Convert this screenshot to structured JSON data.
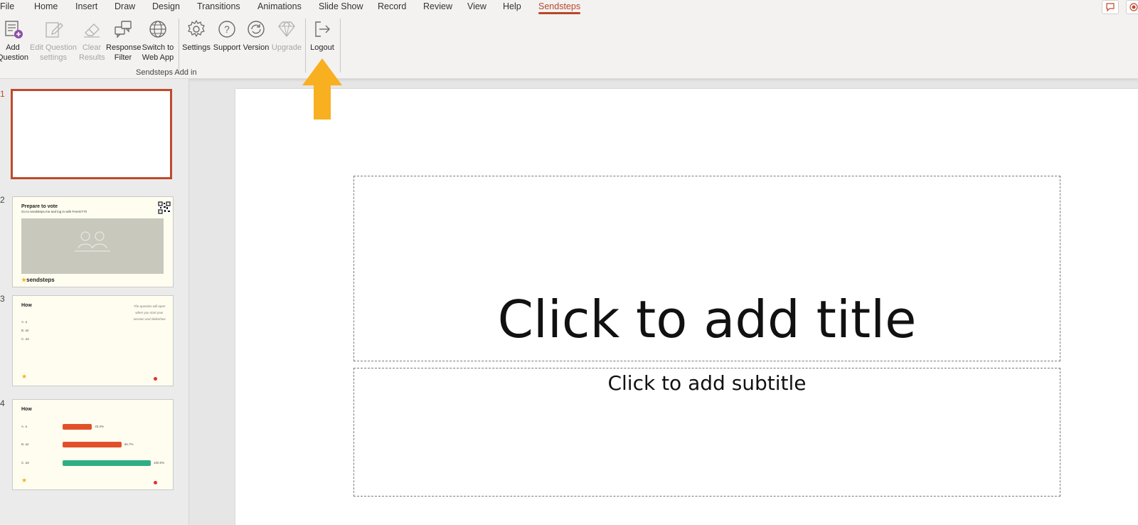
{
  "menu": {
    "items": [
      "File",
      "Home",
      "Insert",
      "Draw",
      "Design",
      "Transitions",
      "Animations",
      "Slide Show",
      "Record",
      "Review",
      "View",
      "Help",
      "Sendsteps"
    ],
    "active": "Sendsteps"
  },
  "ribbon": {
    "buttons": [
      {
        "line1": "Add",
        "line2": "Question",
        "icon": "add-question-icon",
        "enabled": true
      },
      {
        "line1": "Edit Question",
        "line2": "settings",
        "icon": "edit-pencil-icon",
        "enabled": false
      },
      {
        "line1": "Clear",
        "line2": "Results",
        "icon": "eraser-icon",
        "enabled": false
      },
      {
        "line1": "Response",
        "line2": "Filter",
        "icon": "chat-filter-icon",
        "enabled": true
      },
      {
        "line1": "Switch to",
        "line2": "Web App",
        "icon": "globe-icon",
        "enabled": true
      },
      {
        "line1": "Settings",
        "line2": "",
        "icon": "gear-icon",
        "enabled": true
      },
      {
        "line1": "Support",
        "line2": "",
        "icon": "help-icon",
        "enabled": true
      },
      {
        "line1": "Version",
        "line2": "",
        "icon": "refresh-icon",
        "enabled": true
      },
      {
        "line1": "Upgrade",
        "line2": "",
        "icon": "diamond-icon",
        "enabled": false
      },
      {
        "line1": "Logout",
        "line2": "",
        "icon": "logout-icon",
        "enabled": true
      }
    ],
    "group_label": "Sendsteps Add in"
  },
  "thumbnails": {
    "numbers": [
      "1",
      "2",
      "3",
      "4"
    ],
    "slide2": {
      "title": "Prepare to vote",
      "subtitle": "Go to sendsteps.me and log in with FreeGT70",
      "brand": "sendsteps"
    },
    "slide3": {
      "title": "How",
      "options": [
        "A.  a",
        "B.  a2",
        "C.  a3"
      ],
      "comment": "The question will open when you start your session and slideshow"
    },
    "slide4": {
      "title": "How",
      "options": [
        "A.  a",
        "B.  a2",
        "C.  a3"
      ],
      "bars": [
        {
          "label": "33.3%",
          "value": 33.3,
          "color": "#e2502a"
        },
        {
          "label": "66.7%",
          "value": 66.7,
          "color": "#e2502a"
        },
        {
          "label": "100.0%",
          "value": 100.0,
          "color": "#2fae85"
        }
      ]
    }
  },
  "slide": {
    "title_placeholder": "Click to add title",
    "subtitle_placeholder": "Click to add subtitle"
  },
  "colors": {
    "accent": "#b7472a",
    "arrow": "#f8b020"
  }
}
